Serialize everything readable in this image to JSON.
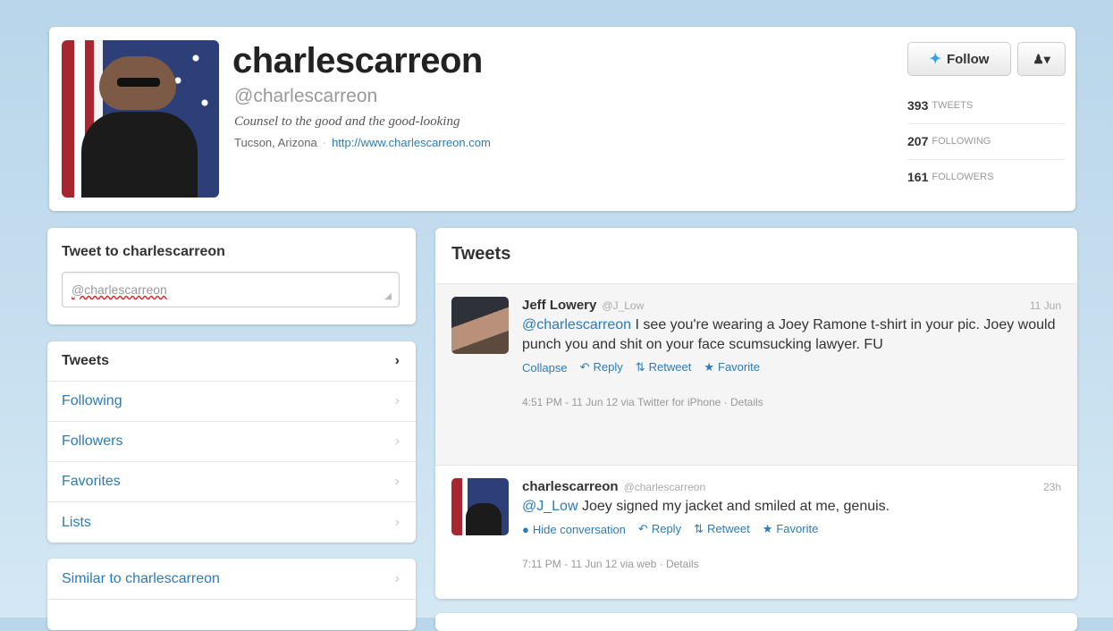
{
  "profile": {
    "name": "charlescarreon",
    "handle": "@charlescarreon",
    "bio": "Counsel to the good and the good-looking",
    "location": "Tucson, Arizona",
    "website": "http://www.charlescarreon.com",
    "follow_label": "Follow",
    "stats": [
      {
        "value": "393",
        "label": "TWEETS"
      },
      {
        "value": "207",
        "label": "FOLLOWING"
      },
      {
        "value": "161",
        "label": "FOLLOWERS"
      }
    ]
  },
  "compose": {
    "title": "Tweet to charlescarreon",
    "value": "@charlescarreon"
  },
  "nav": {
    "items": [
      {
        "label": "Tweets"
      },
      {
        "label": "Following"
      },
      {
        "label": "Followers"
      },
      {
        "label": "Favorites"
      },
      {
        "label": "Lists"
      }
    ],
    "similar": "Similar to charlescarreon"
  },
  "tweets": {
    "title": "Tweets",
    "items": [
      {
        "name": "Jeff Lowery",
        "handle": "@J_Low",
        "time": "11 Jun",
        "mention": "@charlescarreon",
        "text": " I see you're wearing a Joey Ramone t-shirt in your pic. Joey would punch you and shit on your face scumsucking lawyer. FU",
        "actions": [
          "Collapse",
          "Reply",
          "Retweet",
          "Favorite"
        ],
        "meta": "4:51 PM - 11 Jun 12 via Twitter for iPhone · Details"
      },
      {
        "name": "charlescarreon",
        "handle": "@charlescarreon",
        "time": "23h",
        "mention": "@J_Low",
        "text": " Joey signed my jacket and smiled at me, genuis.",
        "actions": [
          "Hide conversation",
          "Reply",
          "Retweet",
          "Favorite"
        ],
        "meta": "7:11 PM - 11 Jun 12 via web · Details"
      }
    ]
  }
}
